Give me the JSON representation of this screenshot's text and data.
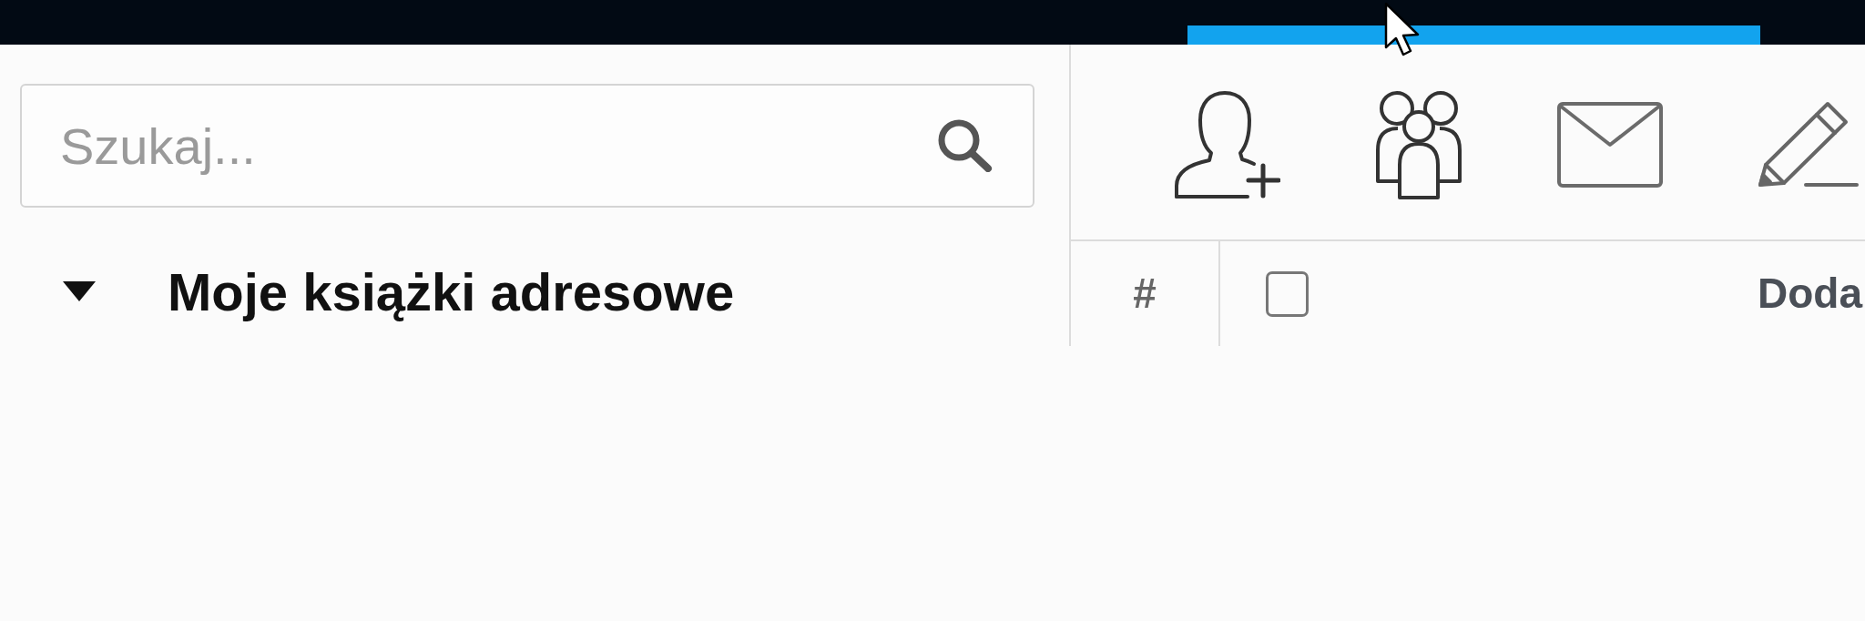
{
  "search": {
    "placeholder": "Szukaj..."
  },
  "tree": [
    {
      "label": "Moje książki adresowe",
      "expanded": true
    }
  ],
  "table": {
    "columns": [
      {
        "kind": "text",
        "label": "#"
      },
      {
        "kind": "checkbox",
        "checked": false
      },
      {
        "kind": "text",
        "label": "Doda"
      }
    ]
  }
}
